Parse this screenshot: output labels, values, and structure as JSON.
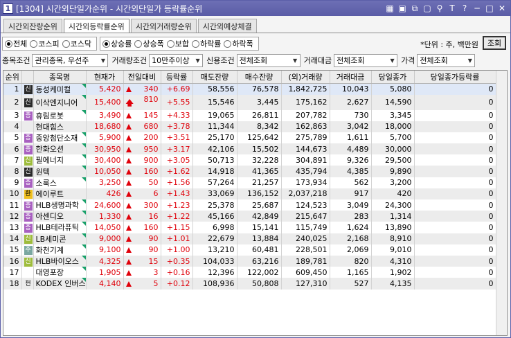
{
  "window": {
    "number": "1",
    "title": "[1304] 시간외단일가순위 - 시간외단일가 등락률순위",
    "buttons": [
      "m-icon",
      "copy-icon",
      "link-icon",
      "pin-icon",
      "font-icon",
      "help-icon",
      "minimize-icon",
      "maximize-icon",
      "close-icon"
    ],
    "button_glyphs": [
      "▦",
      "▣",
      "⧉",
      "▢",
      "⚲",
      "T",
      "?",
      "─",
      "□",
      "✕"
    ]
  },
  "tabs": [
    {
      "label": "시간외잔량순위",
      "active": false
    },
    {
      "label": "시간외등락률순위",
      "active": true
    },
    {
      "label": "시간외거래량순위",
      "active": false
    },
    {
      "label": "시간외예상체결",
      "active": false
    }
  ],
  "market_radios": [
    {
      "label": "전체",
      "on": true
    },
    {
      "label": "코스피",
      "on": false
    },
    {
      "label": "코스닥",
      "on": false
    }
  ],
  "direction_radios": [
    {
      "label": "상승률",
      "on": true
    },
    {
      "label": "상승폭",
      "on": false
    },
    {
      "label": "보합",
      "on": false
    },
    {
      "label": "하락률",
      "on": false
    },
    {
      "label": "하락폭",
      "on": false
    }
  ],
  "unit_text": "*단위 : 주, 백만원",
  "query_label": "조회",
  "filters": {
    "stock_cond_label": "종목조건",
    "stock_cond_value": "관리종목, 우선주",
    "volume_cond_label": "거래량조건",
    "volume_cond_value": "10만주이상",
    "credit_cond_label": "신용조건",
    "credit_cond_value": "전체조회",
    "amount_label": "거래대금",
    "amount_value": "전체조회",
    "price_label": "가격",
    "price_value": "전체조회"
  },
  "columns": [
    "순위",
    "",
    "종목명",
    "현재가",
    "전일대비",
    "등락률",
    "매도잔량",
    "매수잔량",
    "(외)거래량",
    "거래대금",
    "당일종가",
    "당일종가등락률"
  ],
  "rows": [
    {
      "rank": "1",
      "badge": "신",
      "badge_type": "sin",
      "name": "동성케미컬",
      "price": "5,420",
      "arrow": "tri",
      "change": "340",
      "rate": "+6.69",
      "sell": "58,556",
      "buy": "76,578",
      "volume": "1,842,725",
      "amount": "10,043",
      "close": "5,080",
      "close_rate": "0"
    },
    {
      "rank": "2",
      "badge": "신",
      "badge_type": "sin",
      "name": "이삭엔지니어",
      "price": "15,400",
      "arrow": "up",
      "change": "810",
      "rate": "+5.55",
      "sell": "15,546",
      "buy": "3,445",
      "volume": "175,162",
      "amount": "2,627",
      "close": "14,590",
      "close_rate": "0"
    },
    {
      "rank": "3",
      "badge": "증",
      "badge_type": "jeung",
      "name": "휴림로봇",
      "price": "3,490",
      "arrow": "tri",
      "change": "145",
      "rate": "+4.33",
      "sell": "19,065",
      "buy": "26,811",
      "volume": "207,782",
      "amount": "730",
      "close": "3,345",
      "close_rate": "0"
    },
    {
      "rank": "4",
      "badge": "",
      "badge_type": "none",
      "name": "현대힘스",
      "price": "18,680",
      "arrow": "tri",
      "change": "680",
      "rate": "+3.78",
      "sell": "11,344",
      "buy": "8,342",
      "volume": "162,863",
      "amount": "3,042",
      "close": "18,000",
      "close_rate": "0"
    },
    {
      "rank": "5",
      "badge": "증",
      "badge_type": "jeung",
      "name": "중앙첨단소재",
      "price": "5,900",
      "arrow": "tri",
      "change": "200",
      "rate": "+3.51",
      "sell": "25,170",
      "buy": "125,642",
      "volume": "275,789",
      "amount": "1,611",
      "close": "5,700",
      "close_rate": "0"
    },
    {
      "rank": "6",
      "badge": "증",
      "badge_type": "jeung",
      "name": "한화오션",
      "price": "30,950",
      "arrow": "tri",
      "change": "950",
      "rate": "+3.17",
      "sell": "42,106",
      "buy": "15,502",
      "volume": "144,673",
      "amount": "4,489",
      "close": "30,000",
      "close_rate": "0"
    },
    {
      "rank": "7",
      "badge": "신",
      "badge_type": "shin2",
      "name": "필에너지",
      "price": "30,400",
      "arrow": "tri",
      "change": "900",
      "rate": "+3.05",
      "sell": "50,713",
      "buy": "32,228",
      "volume": "304,891",
      "amount": "9,326",
      "close": "29,500",
      "close_rate": "0"
    },
    {
      "rank": "8",
      "badge": "신",
      "badge_type": "sin",
      "name": "원텍",
      "price": "10,050",
      "arrow": "tri",
      "change": "160",
      "rate": "+1.62",
      "sell": "14,918",
      "buy": "41,365",
      "volume": "435,794",
      "amount": "4,385",
      "close": "9,890",
      "close_rate": "0"
    },
    {
      "rank": "9",
      "badge": "증",
      "badge_type": "jeung",
      "name": "소룩스",
      "price": "3,250",
      "arrow": "tri",
      "change": "50",
      "rate": "+1.56",
      "sell": "57,264",
      "buy": "21,257",
      "volume": "173,934",
      "amount": "562",
      "close": "3,200",
      "close_rate": "0"
    },
    {
      "rank": "10",
      "badge": "환",
      "badge_type": "hwan",
      "name": "에이루트",
      "price": "426",
      "arrow": "tri",
      "change": "6",
      "rate": "+1.43",
      "sell": "33,069",
      "buy": "136,152",
      "volume": "2,037,218",
      "amount": "917",
      "close": "420",
      "close_rate": "0"
    },
    {
      "rank": "11",
      "badge": "증",
      "badge_type": "jeung",
      "name": "HLB생명과학",
      "price": "24,600",
      "arrow": "tri",
      "change": "300",
      "rate": "+1.23",
      "sell": "25,378",
      "buy": "25,687",
      "volume": "124,523",
      "amount": "3,049",
      "close": "24,300",
      "close_rate": "0"
    },
    {
      "rank": "12",
      "badge": "증",
      "badge_type": "jeung",
      "name": "아센디오",
      "price": "1,330",
      "arrow": "tri",
      "change": "16",
      "rate": "+1.22",
      "sell": "45,166",
      "buy": "42,849",
      "volume": "215,647",
      "amount": "283",
      "close": "1,314",
      "close_rate": "0"
    },
    {
      "rank": "13",
      "badge": "증",
      "badge_type": "jeung",
      "name": "HLB테라퓨틱",
      "price": "14,050",
      "arrow": "tri",
      "change": "160",
      "rate": "+1.15",
      "sell": "6,998",
      "buy": "15,141",
      "volume": "115,749",
      "amount": "1,624",
      "close": "13,890",
      "close_rate": "0"
    },
    {
      "rank": "14",
      "badge": "신",
      "badge_type": "shin2",
      "name": "LB세미콘",
      "price": "9,000",
      "arrow": "tri",
      "change": "90",
      "rate": "+1.01",
      "sell": "22,679",
      "buy": "13,884",
      "volume": "240,025",
      "amount": "2,168",
      "close": "8,910",
      "close_rate": "0"
    },
    {
      "rank": "15",
      "badge": "주",
      "badge_type": "ju",
      "name": "화천기계",
      "price": "9,100",
      "arrow": "tri",
      "change": "90",
      "rate": "+1.00",
      "sell": "13,210",
      "buy": "60,481",
      "volume": "228,501",
      "amount": "2,069",
      "close": "9,010",
      "close_rate": "0"
    },
    {
      "rank": "16",
      "badge": "신",
      "badge_type": "shin2",
      "name": "HLB바이오스",
      "price": "4,325",
      "arrow": "tri",
      "change": "15",
      "rate": "+0.35",
      "sell": "104,033",
      "buy": "63,216",
      "volume": "189,781",
      "amount": "820",
      "close": "4,310",
      "close_rate": "0"
    },
    {
      "rank": "17",
      "badge": "",
      "badge_type": "none",
      "name": "대영포장",
      "price": "1,905",
      "arrow": "tri",
      "change": "3",
      "rate": "+0.16",
      "sell": "12,396",
      "buy": "122,002",
      "volume": "609,450",
      "amount": "1,165",
      "close": "1,902",
      "close_rate": "0"
    },
    {
      "rank": "18",
      "badge": "펀",
      "badge_type": "pyeon",
      "name": "KODEX 인버스",
      "price": "4,140",
      "arrow": "tri",
      "change": "5",
      "rate": "+0.12",
      "sell": "108,936",
      "buy": "50,808",
      "volume": "127,310",
      "amount": "527",
      "close": "4,135",
      "close_rate": "0"
    }
  ],
  "selected_row": 0,
  "green_corner_rows": [
    0,
    1,
    2,
    4,
    5,
    6,
    7,
    8,
    10,
    11,
    12,
    13,
    14,
    15,
    16,
    17
  ]
}
